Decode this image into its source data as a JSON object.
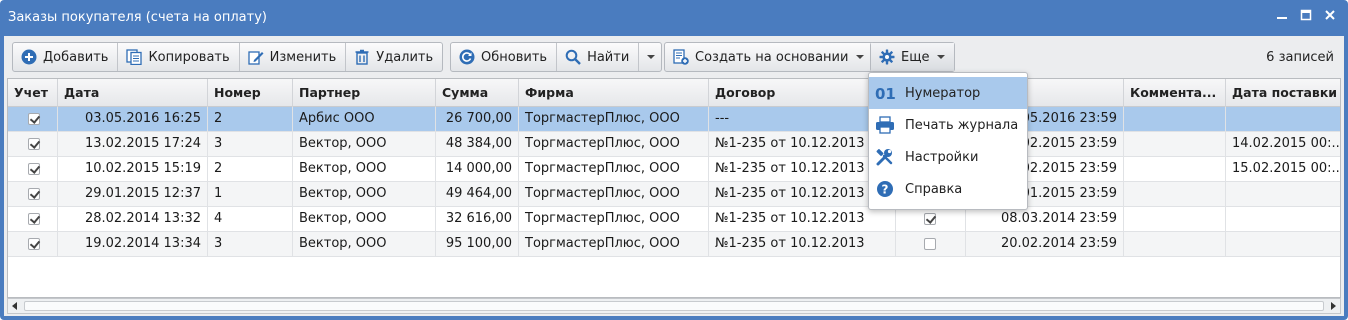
{
  "window": {
    "title": "Заказы покупателя (счета на оплату)",
    "controls": [
      "_",
      "□",
      "✕"
    ]
  },
  "toolbar": {
    "add_label": "Добавить",
    "copy_label": "Копировать",
    "edit_label": "Изменить",
    "delete_label": "Удалить",
    "refresh_label": "Обновить",
    "find_label": "Найти",
    "create_based_label": "Создать на основании",
    "more_label": "Еще",
    "records_count": "6 записей"
  },
  "table": {
    "columns": [
      "Учет",
      "Дата",
      "Номер",
      "Партнер",
      "Сумма",
      "Фирма",
      "Договор",
      "",
      "",
      "зерва",
      "Коммента...",
      "Дата поставки"
    ],
    "rows": [
      {
        "checked": true,
        "date": "03.05.2016 16:25",
        "number": "2",
        "partner": "Арбис ООО",
        "sum": "26 700,00",
        "firm": "ТоргмастерПлюс, ООО",
        "contract": "---",
        "flag": null,
        "reserve": ".05.2016 23:59",
        "comment": "",
        "delivery": ""
      },
      {
        "checked": true,
        "date": "13.02.2015 17:24",
        "number": "3",
        "partner": "Вектор, ООО",
        "sum": "48 384,00",
        "firm": "ТоргмастерПлюс, ООО",
        "contract": "№1-235 от 10.12.2013",
        "flag": null,
        "reserve": ".02.2015 23:59",
        "comment": "",
        "delivery": "14.02.2015 00:..."
      },
      {
        "checked": true,
        "date": "10.02.2015 15:19",
        "number": "2",
        "partner": "Вектор, ООО",
        "sum": "14 000,00",
        "firm": "ТоргмастерПлюс, ООО",
        "contract": "№1-235 от 10.12.2013",
        "flag": null,
        "reserve": ".02.2015 23:59",
        "comment": "",
        "delivery": "15.02.2015 00:..."
      },
      {
        "checked": true,
        "date": "29.01.2015 12:37",
        "number": "1",
        "partner": "Вектор, ООО",
        "sum": "49 464,00",
        "firm": "ТоргмастерПлюс, ООО",
        "contract": "№1-235 от 10.12.2013",
        "flag": null,
        "reserve": ".01.2015 23:59",
        "comment": "",
        "delivery": ""
      },
      {
        "checked": true,
        "date": "28.02.2014 13:32",
        "number": "4",
        "partner": "Вектор, ООО",
        "sum": "32 616,00",
        "firm": "ТоргмастерПлюс, ООО",
        "contract": "№1-235 от 10.12.2013",
        "flag": true,
        "reserve": "08.03.2014 23:59",
        "comment": "",
        "delivery": ""
      },
      {
        "checked": true,
        "date": "19.02.2014 13:34",
        "number": "3",
        "partner": "Вектор, ООО",
        "sum": "95 100,00",
        "firm": "ТоргмастерПлюс, ООО",
        "contract": "№1-235 от 10.12.2013",
        "flag": false,
        "reserve": "20.02.2014 23:59",
        "comment": "",
        "delivery": ""
      }
    ],
    "selected_row": 0
  },
  "menu": {
    "items": [
      {
        "label": "Нумератор",
        "icon": "numerator-icon",
        "highlighted": true
      },
      {
        "label": "Печать журнала",
        "icon": "printer-icon",
        "highlighted": false
      },
      {
        "label": "Настройки",
        "icon": "wrench-icon",
        "highlighted": false
      },
      {
        "label": "Справка",
        "icon": "help-icon",
        "highlighted": false
      }
    ]
  },
  "colors": {
    "title_bar": "#4a7cbf",
    "selection": "#a9c9ec",
    "icon_blue": "#2f6db5"
  }
}
